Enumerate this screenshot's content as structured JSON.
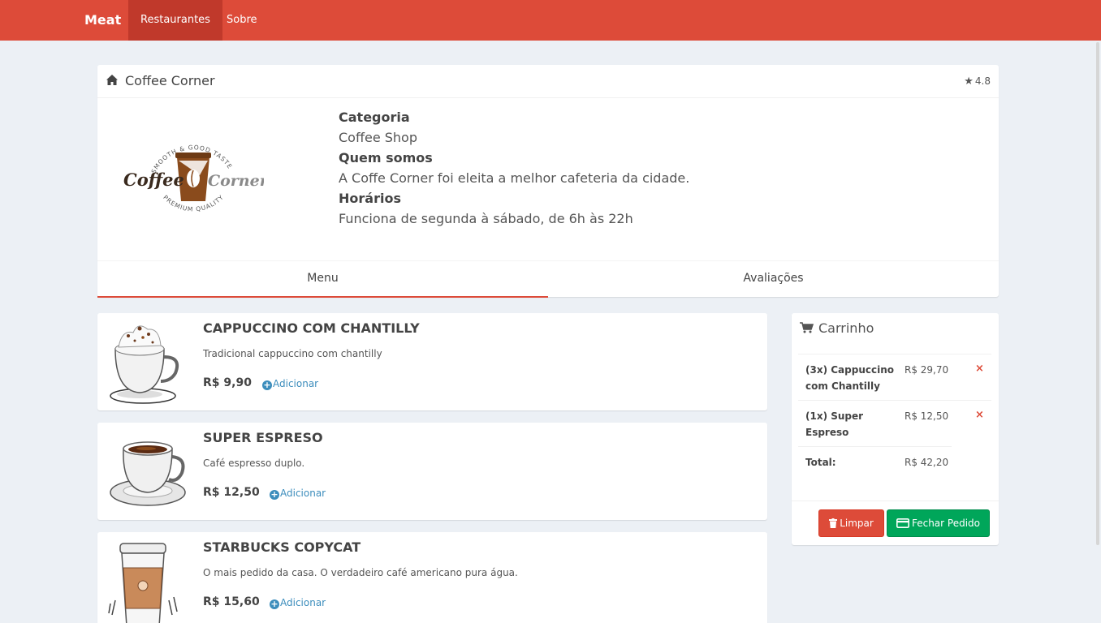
{
  "navbar": {
    "brand": "Meat",
    "items": [
      {
        "label": "Restaurantes",
        "active": true
      },
      {
        "label": "Sobre",
        "active": false
      }
    ],
    "color": "#dd4b39"
  },
  "restaurant": {
    "name": "Coffee Corner",
    "rating": "4.8",
    "logo_text": {
      "top": "SMOOTH & GOOD TASTE",
      "left": "Coffee",
      "right": "Corner",
      "bottom": "PREMIUM QUALITY"
    },
    "category_label": "Categoria",
    "category": "Coffee Shop",
    "about_label": "Quem somos",
    "about": "A Coffe Corner foi eleita a melhor cafeteria da cidade.",
    "hours_label": "Horários",
    "hours": "Funciona de segunda à sábado, de 6h às 22h"
  },
  "tabs": [
    {
      "label": "Menu",
      "active": true
    },
    {
      "label": "Avaliações",
      "active": false
    }
  ],
  "menu": [
    {
      "title": "CAPPUCCINO COM CHANTILLY",
      "desc": "Tradicional cappuccino com chantilly",
      "price": "R$ 9,90",
      "add": "Adicionar",
      "image": "cappuccino-cup"
    },
    {
      "title": "SUPER ESPRESO",
      "desc": "Café espresso duplo.",
      "price": "R$ 12,50",
      "add": "Adicionar",
      "image": "espresso-cup"
    },
    {
      "title": "STARBUCKS COPYCAT",
      "desc": "O mais pedido da casa. O verdadeiro café americano pura água.",
      "price": "R$ 15,60",
      "add": "Adicionar",
      "image": "takeaway-cup"
    }
  ],
  "cart": {
    "title": "Carrinho",
    "items": [
      {
        "name": "(3x) Cappuccino com Chantilly",
        "price": "R$ 29,70",
        "remove": "×"
      },
      {
        "name": "(1x) Super Espreso",
        "price": "R$ 12,50",
        "remove": "×"
      }
    ],
    "total_label": "Total:",
    "total": "R$ 42,20",
    "clear_label": "Limpar",
    "checkout_label": "Fechar Pedido"
  },
  "colors": {
    "danger": "#dd4b39",
    "success": "#00a65a",
    "link": "#3c8dbc"
  }
}
